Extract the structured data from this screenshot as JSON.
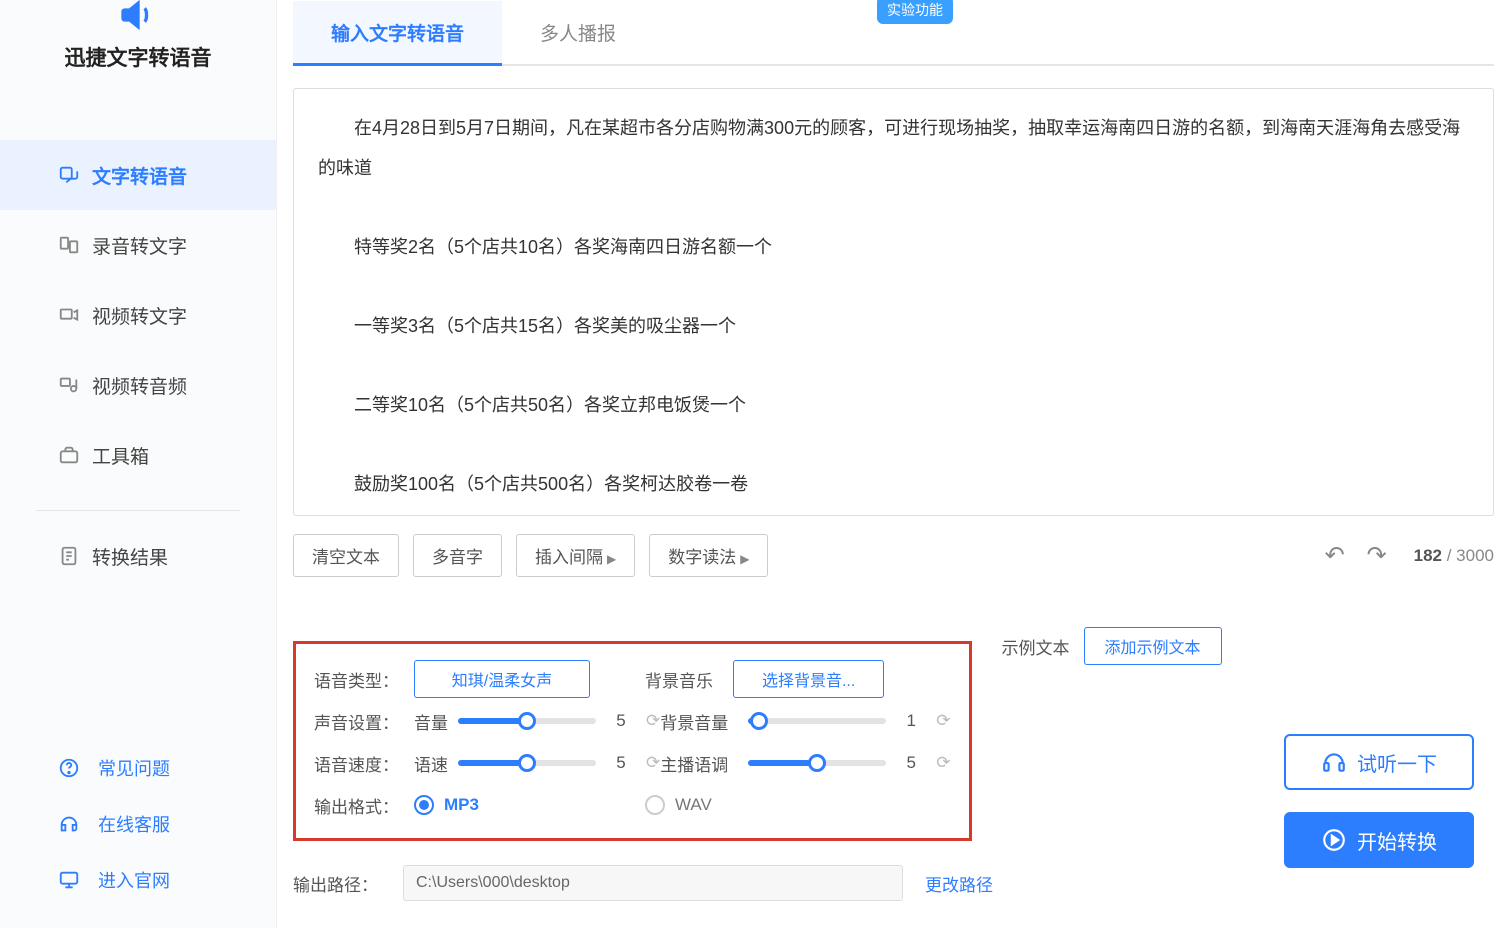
{
  "brand": {
    "title": "迅捷文字转语音"
  },
  "sidebar": {
    "items": [
      {
        "label": "文字转语音"
      },
      {
        "label": "录音转文字"
      },
      {
        "label": "视频转文字"
      },
      {
        "label": "视频转音频"
      },
      {
        "label": "工具箱"
      }
    ],
    "results_label": "转换结果"
  },
  "footer": {
    "faq": "常见问题",
    "support": "在线客服",
    "website": "进入官网"
  },
  "tabs": {
    "tts": "输入文字转语音",
    "multi": "多人播报",
    "badge": "实验功能"
  },
  "editor": {
    "lines": [
      "在4月28日到5月7日期间，凡在某超市各分店购物满300元的顾客，可进行现场抽奖，抽取幸运海南四日游的名额，到海南天涯海角去感受海的味道",
      "特等奖2名（5个店共10名）各奖海南四日游名额一个",
      "一等奖3名（5个店共15名）各奖美的吸尘器一个",
      "二等奖10名（5个店共50名）各奖立邦电饭煲一个",
      "鼓励奖100名（5个店共500名）各奖柯达胶卷一卷"
    ]
  },
  "toolbar": {
    "clear": "清空文本",
    "polyphone": "多音字",
    "insert_pause": "插入间隔",
    "number_read": "数字读法",
    "count_current": "182",
    "count_sep": " / ",
    "count_max": "3000"
  },
  "settings": {
    "voice_type_label": "语音类型：",
    "voice_name": "知琪/温柔女声",
    "bgm_label": "背景音乐",
    "bgm_choose": "选择背景音...",
    "sound_label": "声音设置：",
    "volume_label": "音量",
    "volume_value": "5",
    "bgm_vol_label": "背景音量",
    "bgm_vol_value": "1",
    "speed_label": "语音速度：",
    "speed_sub": "语速",
    "speed_value": "5",
    "pitch_label": "主播语调",
    "pitch_value": "5",
    "format_label": "输出格式：",
    "mp3": "MP3",
    "wav": "WAV"
  },
  "sample": {
    "label": "示例文本",
    "button": "添加示例文本"
  },
  "output": {
    "label": "输出路径：",
    "path": "C:\\Users\\000\\desktop",
    "change": "更改路径"
  },
  "actions": {
    "preview": "试听一下",
    "convert": "开始转换"
  }
}
